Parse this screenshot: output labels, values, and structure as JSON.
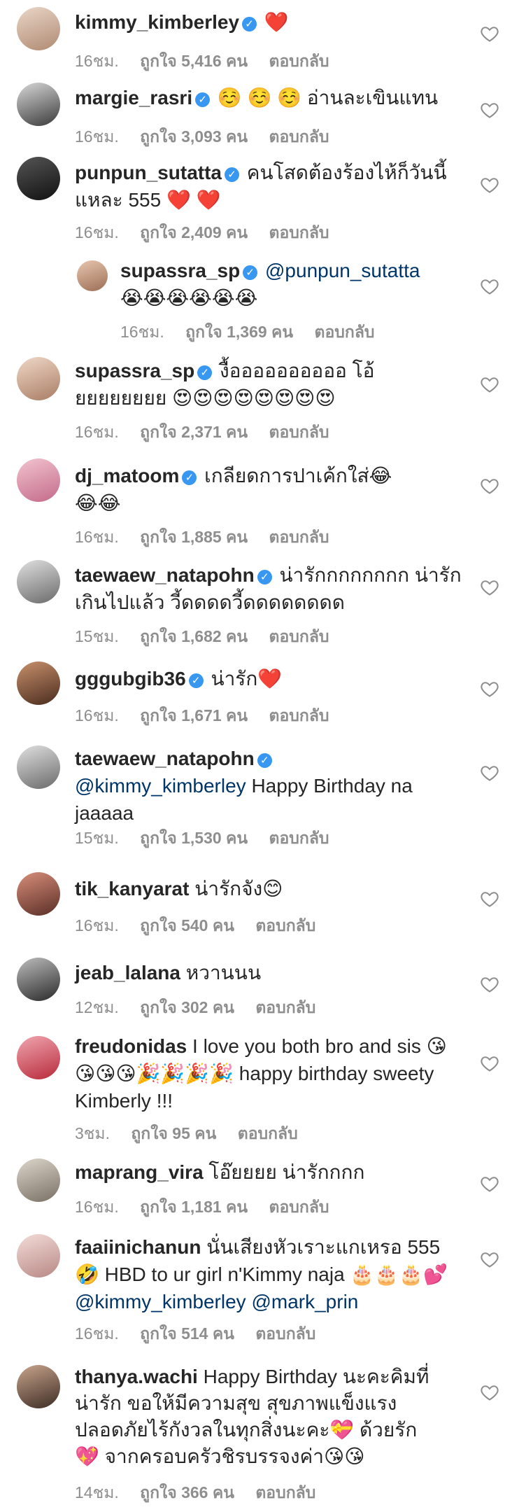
{
  "colors": {
    "verified": "#3897f0",
    "meta": "#8e8e8e",
    "mention": "#003569",
    "heart_outline": "#8e8e8e"
  },
  "icons": {
    "verified": "verified-badge-icon",
    "like": "heart-outline-icon"
  },
  "comments": [
    {
      "username": "kimmy_kimberley",
      "verified": true,
      "text": "❤️",
      "time": "16ชม.",
      "likes": "ถูกใจ 5,416 คน",
      "reply": "ตอบกลับ"
    },
    {
      "username": "margie_rasri",
      "verified": true,
      "text": "☺️ ☺️ ☺️ อ่านละเขินแทน",
      "time": "16ชม.",
      "likes": "ถูกใจ 3,093 คน",
      "reply": "ตอบกลับ"
    },
    {
      "username": "punpun_sutatta",
      "verified": true,
      "text": "คนโสดต้องร้องไห้ก็วันนี้แหละ 555 ❤️ ❤️",
      "time": "16ชม.",
      "likes": "ถูกใจ 2,409 คน",
      "reply": "ตอบกลับ"
    },
    {
      "username": "supassra_sp",
      "verified": true,
      "mention": "@punpun_sutatta",
      "text": "😭😭😭😭😭😭",
      "time": "16ชม.",
      "likes": "ถูกใจ 1,369 คน",
      "reply": "ตอบกลับ",
      "is_reply": true
    },
    {
      "username": "supassra_sp",
      "verified": true,
      "text": "งื้ออออออออออ โอ้ยยยยยยยย 😍😍😍😍😍😍😍😍",
      "time": "16ชม.",
      "likes": "ถูกใจ 2,371 คน",
      "reply": "ตอบกลับ"
    },
    {
      "username": "dj_matoom",
      "verified": true,
      "text": "เกลียดการปาเค้กใส่😂😂😂",
      "time": "16ชม.",
      "likes": "ถูกใจ 1,885 คน",
      "reply": "ตอบกลับ"
    },
    {
      "username": "taewaew_natapohn",
      "verified": true,
      "text": "น่ารักกกกกกกก น่ารักเกินไปแล้ว วี้ดดดดวี้ดดดดดดดด",
      "time": "15ชม.",
      "likes": "ถูกใจ 1,682 คน",
      "reply": "ตอบกลับ"
    },
    {
      "username": "gggubgib36",
      "verified": true,
      "text": "น่ารัก❤️",
      "time": "16ชม.",
      "likes": "ถูกใจ 1,671 คน",
      "reply": "ตอบกลับ"
    },
    {
      "username": "taewaew_natapohn",
      "verified": true,
      "mention": "@kimmy_kimberley",
      "text": "Happy Birthday na jaaaaa",
      "time": "15ชม.",
      "likes": "ถูกใจ 1,530 คน",
      "reply": "ตอบกลับ"
    },
    {
      "username": "tik_kanyarat",
      "verified": false,
      "text": "น่ารักจัง😊",
      "time": "16ชม.",
      "likes": "ถูกใจ 540 คน",
      "reply": "ตอบกลับ"
    },
    {
      "username": "jeab_lalana",
      "verified": false,
      "text": "หวานนน",
      "time": "12ชม.",
      "likes": "ถูกใจ 302 คน",
      "reply": "ตอบกลับ"
    },
    {
      "username": "freudonidas",
      "verified": false,
      "text": "I love you both bro and sis 😘😘😘😘🎉🎉🎉🎉 happy birthday sweety Kimberly !!!",
      "time": "3ชม.",
      "likes": "ถูกใจ 95 คน",
      "reply": "ตอบกลับ"
    },
    {
      "username": "maprang_vira",
      "verified": false,
      "text": "โอ๊ยยยย น่ารักกกก",
      "time": "16ชม.",
      "likes": "ถูกใจ 1,181 คน",
      "reply": "ตอบกลับ"
    },
    {
      "username": "faaiinichanun",
      "verified": false,
      "text": "นั่นเสียงหัวเราะแกเหรอ 555 🤣 HBD to ur girl n'Kimmy naja 🎂🎂🎂💕",
      "mention_after": "@kimmy_kimberley @mark_prin",
      "time": "16ชม.",
      "likes": "ถูกใจ 514 คน",
      "reply": "ตอบกลับ"
    },
    {
      "username": "thanya.wachi",
      "verified": false,
      "text": "Happy Birthday นะคะคิมที่น่ารัก ขอให้มีความสุข สุขภาพแข็งแรง ปลอดภัยไร้กังวลในทุกสิ่งนะคะ💝 ด้วยรัก💖 จากครอบครัวชิรบรรจงค่า😘😘",
      "time": "14ชม.",
      "likes": "ถูกใจ 366 คน",
      "reply": "ตอบกลับ"
    }
  ]
}
